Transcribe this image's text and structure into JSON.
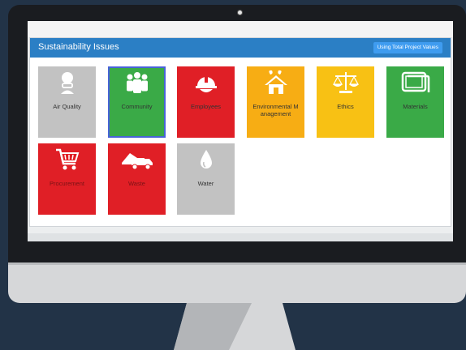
{
  "panel": {
    "title": "Sustainability Issues",
    "button_label": "Using Total Project Values"
  },
  "colors": {
    "header_blue": "#2b7fc5",
    "button_blue": "#3f9cf0",
    "gray": "#c2c2c2",
    "green": "#3aaa47",
    "red": "#e01f26",
    "orange": "#f7ad14",
    "yellow": "#f8c114",
    "selected_outline": "#4863d8"
  },
  "tiles": [
    {
      "label": "Air Quality",
      "color": "#c2c2c2",
      "icon": "air-quality-icon"
    },
    {
      "label": "Community",
      "color": "#3aaa47",
      "icon": "community-icon",
      "selected": true
    },
    {
      "label": "Employees",
      "color": "#e01f26",
      "icon": "hard-hat-icon"
    },
    {
      "label": "Environmental Management",
      "color": "#f7ad14",
      "icon": "eco-house-icon"
    },
    {
      "label": "Ethics",
      "color": "#f8c114",
      "icon": "scales-icon"
    },
    {
      "label": "Materials",
      "color": "#3aaa47",
      "icon": "materials-icon"
    },
    {
      "label": "Procurement",
      "color": "#e01f26",
      "icon": "shopping-cart-icon"
    },
    {
      "label": "Waste",
      "color": "#e01f26",
      "icon": "dump-truck-icon"
    },
    {
      "label": "Water",
      "color": "#c2c2c2",
      "icon": "water-drop-icon"
    }
  ]
}
